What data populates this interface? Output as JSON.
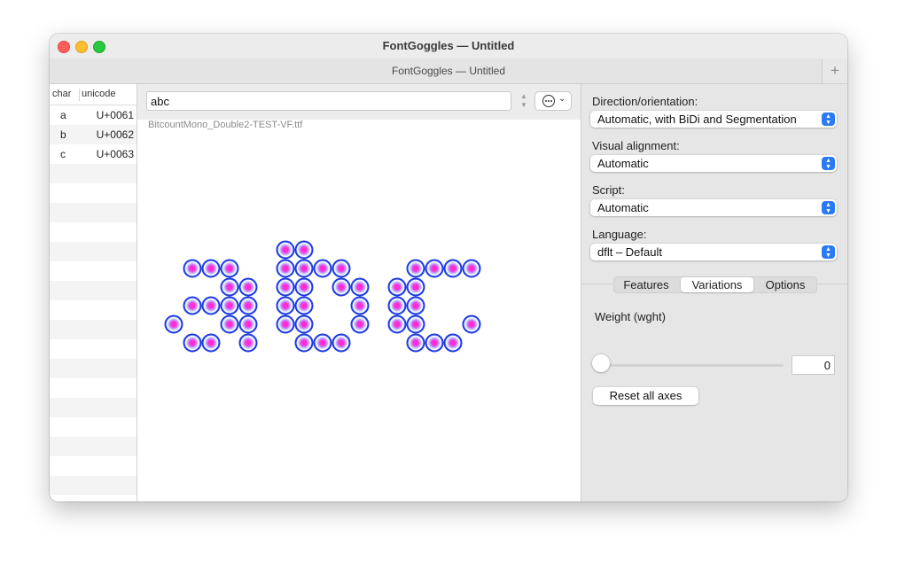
{
  "window": {
    "title": "FontGoggles — Untitled",
    "tab_title": "FontGoggles — Untitled",
    "new_tab_label": "+"
  },
  "glyph_list": {
    "columns": [
      "char",
      "unicode"
    ],
    "rows": [
      {
        "char": "a",
        "unicode": "U+0061"
      },
      {
        "char": "b",
        "unicode": "U+0062"
      },
      {
        "char": "c",
        "unicode": "U+0063"
      }
    ]
  },
  "text_field": {
    "value": "abc"
  },
  "font": {
    "file_name": "BitcountMono_Double2-TEST-VF.ttf"
  },
  "rendered_glyphs": {
    "colors": {
      "ring": "#1d3ce0",
      "inner": "#b6a6ff",
      "center": "#ff2bd6"
    },
    "glyphs": [
      {
        "char": "a",
        "cells": [
          [
            1,
            5
          ],
          [
            2,
            5
          ],
          [
            3,
            5
          ],
          [
            3,
            4
          ],
          [
            4,
            4
          ],
          [
            1,
            3
          ],
          [
            2,
            3
          ],
          [
            3,
            3
          ],
          [
            4,
            3
          ],
          [
            0,
            2
          ],
          [
            3,
            2
          ],
          [
            4,
            2
          ],
          [
            1,
            1
          ],
          [
            2,
            1
          ],
          [
            4,
            1
          ]
        ]
      },
      {
        "char": "b",
        "cells": [
          [
            0,
            6
          ],
          [
            1,
            6
          ],
          [
            0,
            5
          ],
          [
            1,
            5
          ],
          [
            2,
            5
          ],
          [
            3,
            5
          ],
          [
            0,
            4
          ],
          [
            1,
            4
          ],
          [
            3,
            4
          ],
          [
            4,
            4
          ],
          [
            0,
            3
          ],
          [
            1,
            3
          ],
          [
            4,
            3
          ],
          [
            0,
            2
          ],
          [
            1,
            2
          ],
          [
            4,
            2
          ],
          [
            1,
            1
          ],
          [
            2,
            1
          ],
          [
            3,
            1
          ]
        ]
      },
      {
        "char": "c",
        "cells": [
          [
            1,
            5
          ],
          [
            2,
            5
          ],
          [
            3,
            5
          ],
          [
            4,
            5
          ],
          [
            0,
            4
          ],
          [
            1,
            4
          ],
          [
            0,
            3
          ],
          [
            1,
            3
          ],
          [
            0,
            2
          ],
          [
            1,
            2
          ],
          [
            4,
            2
          ],
          [
            1,
            1
          ],
          [
            2,
            1
          ],
          [
            3,
            1
          ]
        ]
      }
    ]
  },
  "sidebar": {
    "direction_label": "Direction/orientation:",
    "direction_value": "Automatic, with BiDi and Segmentation",
    "alignment_label": "Visual alignment:",
    "alignment_value": "Automatic",
    "script_label": "Script:",
    "script_value": "Automatic",
    "language_label": "Language:",
    "language_value": "dflt – Default",
    "tabs": [
      "Features",
      "Variations",
      "Options"
    ],
    "active_tab": "Variations",
    "axis_label": "Weight (wght)",
    "axis_value": "0",
    "reset_label": "Reset all axes",
    "accent_color": "#2a7af6"
  }
}
